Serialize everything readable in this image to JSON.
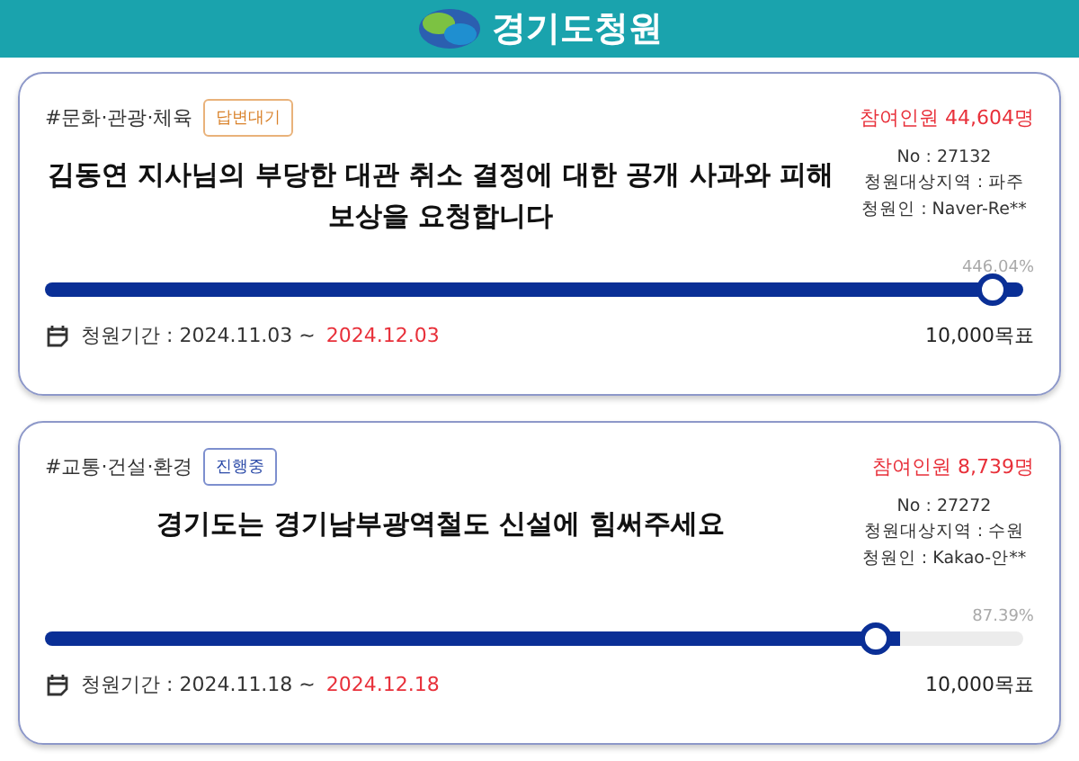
{
  "header": {
    "title": "경기도청원"
  },
  "petitions": [
    {
      "category": "#문화·관광·체육",
      "status": {
        "label": "답변대기",
        "kind": "waiting"
      },
      "participants": "참여인원 44,604명",
      "title": "김동연 지사님의 부당한 대관 취소 결정에 대한 공개 사과와 피해 보상을 요청합니다",
      "number": "No : 27132",
      "region": "청원대상지역 : 파주",
      "author": "청원인 : Naver-Re**",
      "percent": "446.04%",
      "level": 1,
      "period_label": "청원기간 : 2024.11.03 ~",
      "period_end": "2024.12.03",
      "goal": "10,000목표"
    },
    {
      "category": "#교통·건설·환경",
      "status": {
        "label": "진행중",
        "kind": "ongoing"
      },
      "participants": "참여인원 8,739명",
      "title": "경기도는 경기남부광역철도 신설에 힘써주세요",
      "number": "No : 27272",
      "region": "청원대상지역 : 수원",
      "author": "청원인 : Kakao-안**",
      "percent": "87.39%",
      "level": 0.8739,
      "period_label": "청원기간 : 2024.11.18 ~",
      "period_end": "2024.12.18",
      "goal": "10,000목표"
    }
  ]
}
